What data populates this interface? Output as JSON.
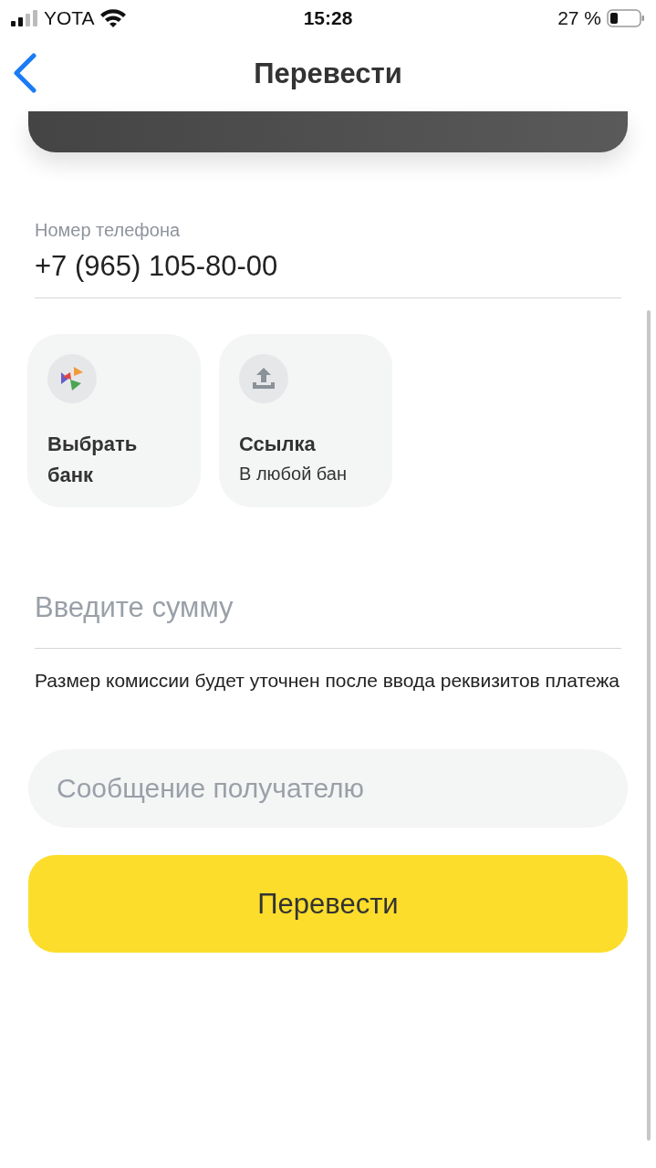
{
  "status_bar": {
    "carrier": "YOTA",
    "time": "15:28",
    "battery": "27 %"
  },
  "nav": {
    "title": "Перевести"
  },
  "phone": {
    "label": "Номер телефона",
    "value": "+7 (965) 105-80-00"
  },
  "options": [
    {
      "kind": "bank",
      "title": "Выбрать банк"
    },
    {
      "kind": "link",
      "title": "Ссылка",
      "subtitle": "В любой бан"
    }
  ],
  "amount": {
    "placeholder": "Введите сумму"
  },
  "note": "Размер комиссии будет уточнен после ввода реквизитов платежа",
  "message": {
    "placeholder": "Сообщение получателю"
  },
  "submit": "Перевести"
}
